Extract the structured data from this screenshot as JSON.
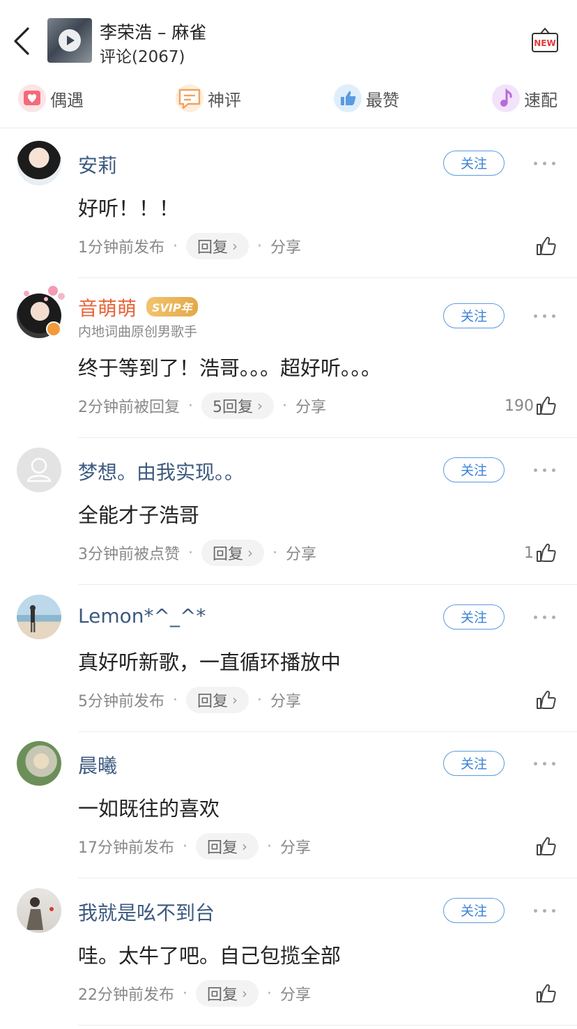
{
  "header": {
    "song_title": "李荣浩 – 麻雀",
    "comment_count": "评论(2067)",
    "new_label": "NEW"
  },
  "tabs": [
    {
      "label": "偶遇",
      "icon": "heart-icon",
      "color": "#f26b7a"
    },
    {
      "label": "神评",
      "icon": "chat-bubble-icon",
      "color": "#f2a25c"
    },
    {
      "label": "最赞",
      "icon": "thumbs-up-icon",
      "color": "#5a9be0"
    },
    {
      "label": "速配",
      "icon": "music-note-icon",
      "color": "#b76ad9"
    }
  ],
  "comments": [
    {
      "name": "安莉",
      "text": "好听！！！",
      "time": "1分钟前发布",
      "reply": "回复",
      "share": "分享",
      "likes": ""
    },
    {
      "name": "音萌萌",
      "badge": "SVIP年",
      "subtitle": "内地词曲原创男歌手",
      "text": "终于等到了！浩哥。。。超好听。。。",
      "time": "2分钟前被回复",
      "reply": "5回复",
      "share": "分享",
      "likes": "190"
    },
    {
      "name": "梦想。由我实现。。",
      "text": "全能才子浩哥",
      "time": "3分钟前被点赞",
      "reply": "回复",
      "share": "分享",
      "likes": "1"
    },
    {
      "name": "Lemon*^_^*",
      "text": "真好听新歌，一直循环播放中",
      "time": "5分钟前发布",
      "reply": "回复",
      "share": "分享",
      "likes": ""
    },
    {
      "name": "晨曦",
      "text": "一如既往的喜欢",
      "time": "17分钟前发布",
      "reply": "回复",
      "share": "分享",
      "likes": ""
    },
    {
      "name": "我就是吆不到台",
      "text": "哇。太牛了吧。自己包揽全部",
      "time": "22分钟前发布",
      "reply": "回复",
      "share": "分享",
      "likes": ""
    }
  ],
  "follow_label": "关注",
  "colors": {
    "link_blue": "#3d5a80",
    "accent_blue": "#3a82d6",
    "vip_orange": "#e8643a"
  }
}
